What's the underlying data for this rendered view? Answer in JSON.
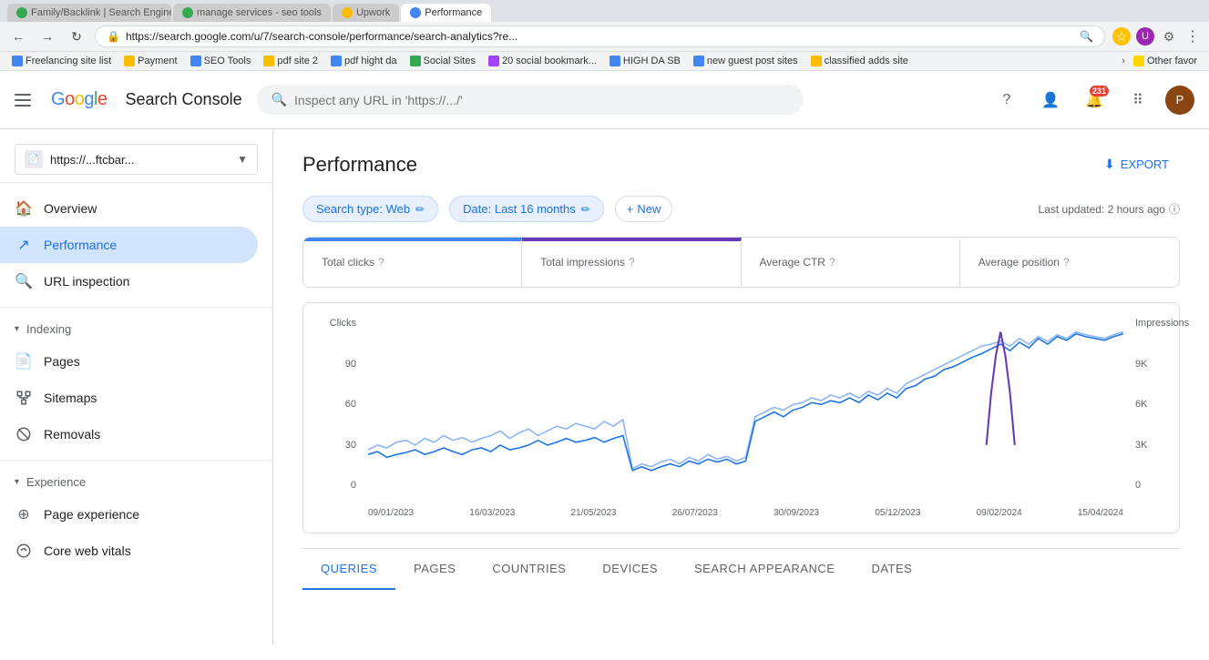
{
  "browser": {
    "tabs": [
      {
        "label": "Family/Backlink | Search Engine ...",
        "favicon": "green",
        "active": false
      },
      {
        "label": "manage services - seo tools",
        "favicon": "green",
        "active": false
      },
      {
        "label": "Upwork",
        "favicon": "orange",
        "active": false
      },
      {
        "label": "Performance",
        "favicon": "blue",
        "active": true
      }
    ],
    "address_bar": "https://search.google.com/u/7/search-console/performance/search-analytics?re...",
    "bookmarks": [
      {
        "label": "Freelancing site list",
        "icon": "blue"
      },
      {
        "label": "Payment",
        "icon": "orange"
      },
      {
        "label": "SEO Tools",
        "icon": "blue"
      },
      {
        "label": "pdf site 2",
        "icon": "orange"
      },
      {
        "label": "pdf hight da",
        "icon": "blue"
      },
      {
        "label": "Social Sites",
        "icon": "green"
      },
      {
        "label": "20 social bookmark...",
        "icon": "purple"
      },
      {
        "label": "HIGH DA SB",
        "icon": "blue"
      },
      {
        "label": "new guest post sites",
        "icon": "blue"
      },
      {
        "label": "classified adds site",
        "icon": "orange"
      }
    ],
    "bookmarks_more": "Other favor",
    "notification_count": "231"
  },
  "header": {
    "google_text": "Google",
    "app_name": "Search Console",
    "search_placeholder": "Inspect any URL in 'https://.../'",
    "avatar_text": "P"
  },
  "sidebar": {
    "property": "https://...ftcbar...",
    "nav_items": [
      {
        "id": "overview",
        "label": "Overview",
        "icon": "home",
        "active": false
      },
      {
        "id": "performance",
        "label": "Performance",
        "icon": "trending_up",
        "active": true
      },
      {
        "id": "url-inspection",
        "label": "URL inspection",
        "icon": "search",
        "active": false
      }
    ],
    "sections": [
      {
        "label": "Indexing",
        "items": [
          {
            "id": "pages",
            "label": "Pages",
            "icon": "page"
          },
          {
            "id": "sitemaps",
            "label": "Sitemaps",
            "icon": "sitemap"
          },
          {
            "id": "removals",
            "label": "Removals",
            "icon": "remove"
          }
        ]
      },
      {
        "label": "Experience",
        "items": [
          {
            "id": "page-experience",
            "label": "Page experience",
            "icon": "experience"
          },
          {
            "id": "core-web-vitals",
            "label": "Core web vitals",
            "icon": "vitals"
          }
        ]
      }
    ]
  },
  "content": {
    "page_title": "Performance",
    "export_label": "EXPORT",
    "filters": {
      "search_type_label": "Search type: Web",
      "date_label": "Date: Last 16 months",
      "add_new_label": "New"
    },
    "last_updated": "Last updated: 2 hours ago",
    "metrics": [
      {
        "id": "total-clicks",
        "label": "Total clicks",
        "value": "",
        "style": "active-blue"
      },
      {
        "id": "total-impressions",
        "label": "Total impressions",
        "value": "",
        "style": "active-purple"
      },
      {
        "id": "avg-ctr",
        "label": "Average CTR",
        "value": "",
        "style": "inactive"
      },
      {
        "id": "avg-position",
        "label": "Average position",
        "value": "",
        "style": "inactive"
      }
    ],
    "chart": {
      "y_left_label": "Clicks",
      "y_right_label": "Impressions",
      "y_left_values": [
        "90",
        "60",
        "30",
        "0"
      ],
      "y_right_values": [
        "9K",
        "6K",
        "3K",
        "0"
      ],
      "x_labels": [
        "09/01/2023",
        "16/03/2023",
        "21/05/2023",
        "26/07/2023",
        "30/09/2023",
        "05/12/2023",
        "09/02/2024",
        "15/04/2024"
      ]
    },
    "tabs": [
      {
        "id": "queries",
        "label": "QUERIES",
        "active": true
      },
      {
        "id": "pages",
        "label": "PAGES",
        "active": false
      },
      {
        "id": "countries",
        "label": "COUNTRIES",
        "active": false
      },
      {
        "id": "devices",
        "label": "DEVICES",
        "active": false
      },
      {
        "id": "search-appearance",
        "label": "SEARCH APPEARANCE",
        "active": false
      },
      {
        "id": "dates",
        "label": "DATES",
        "active": false
      }
    ]
  }
}
